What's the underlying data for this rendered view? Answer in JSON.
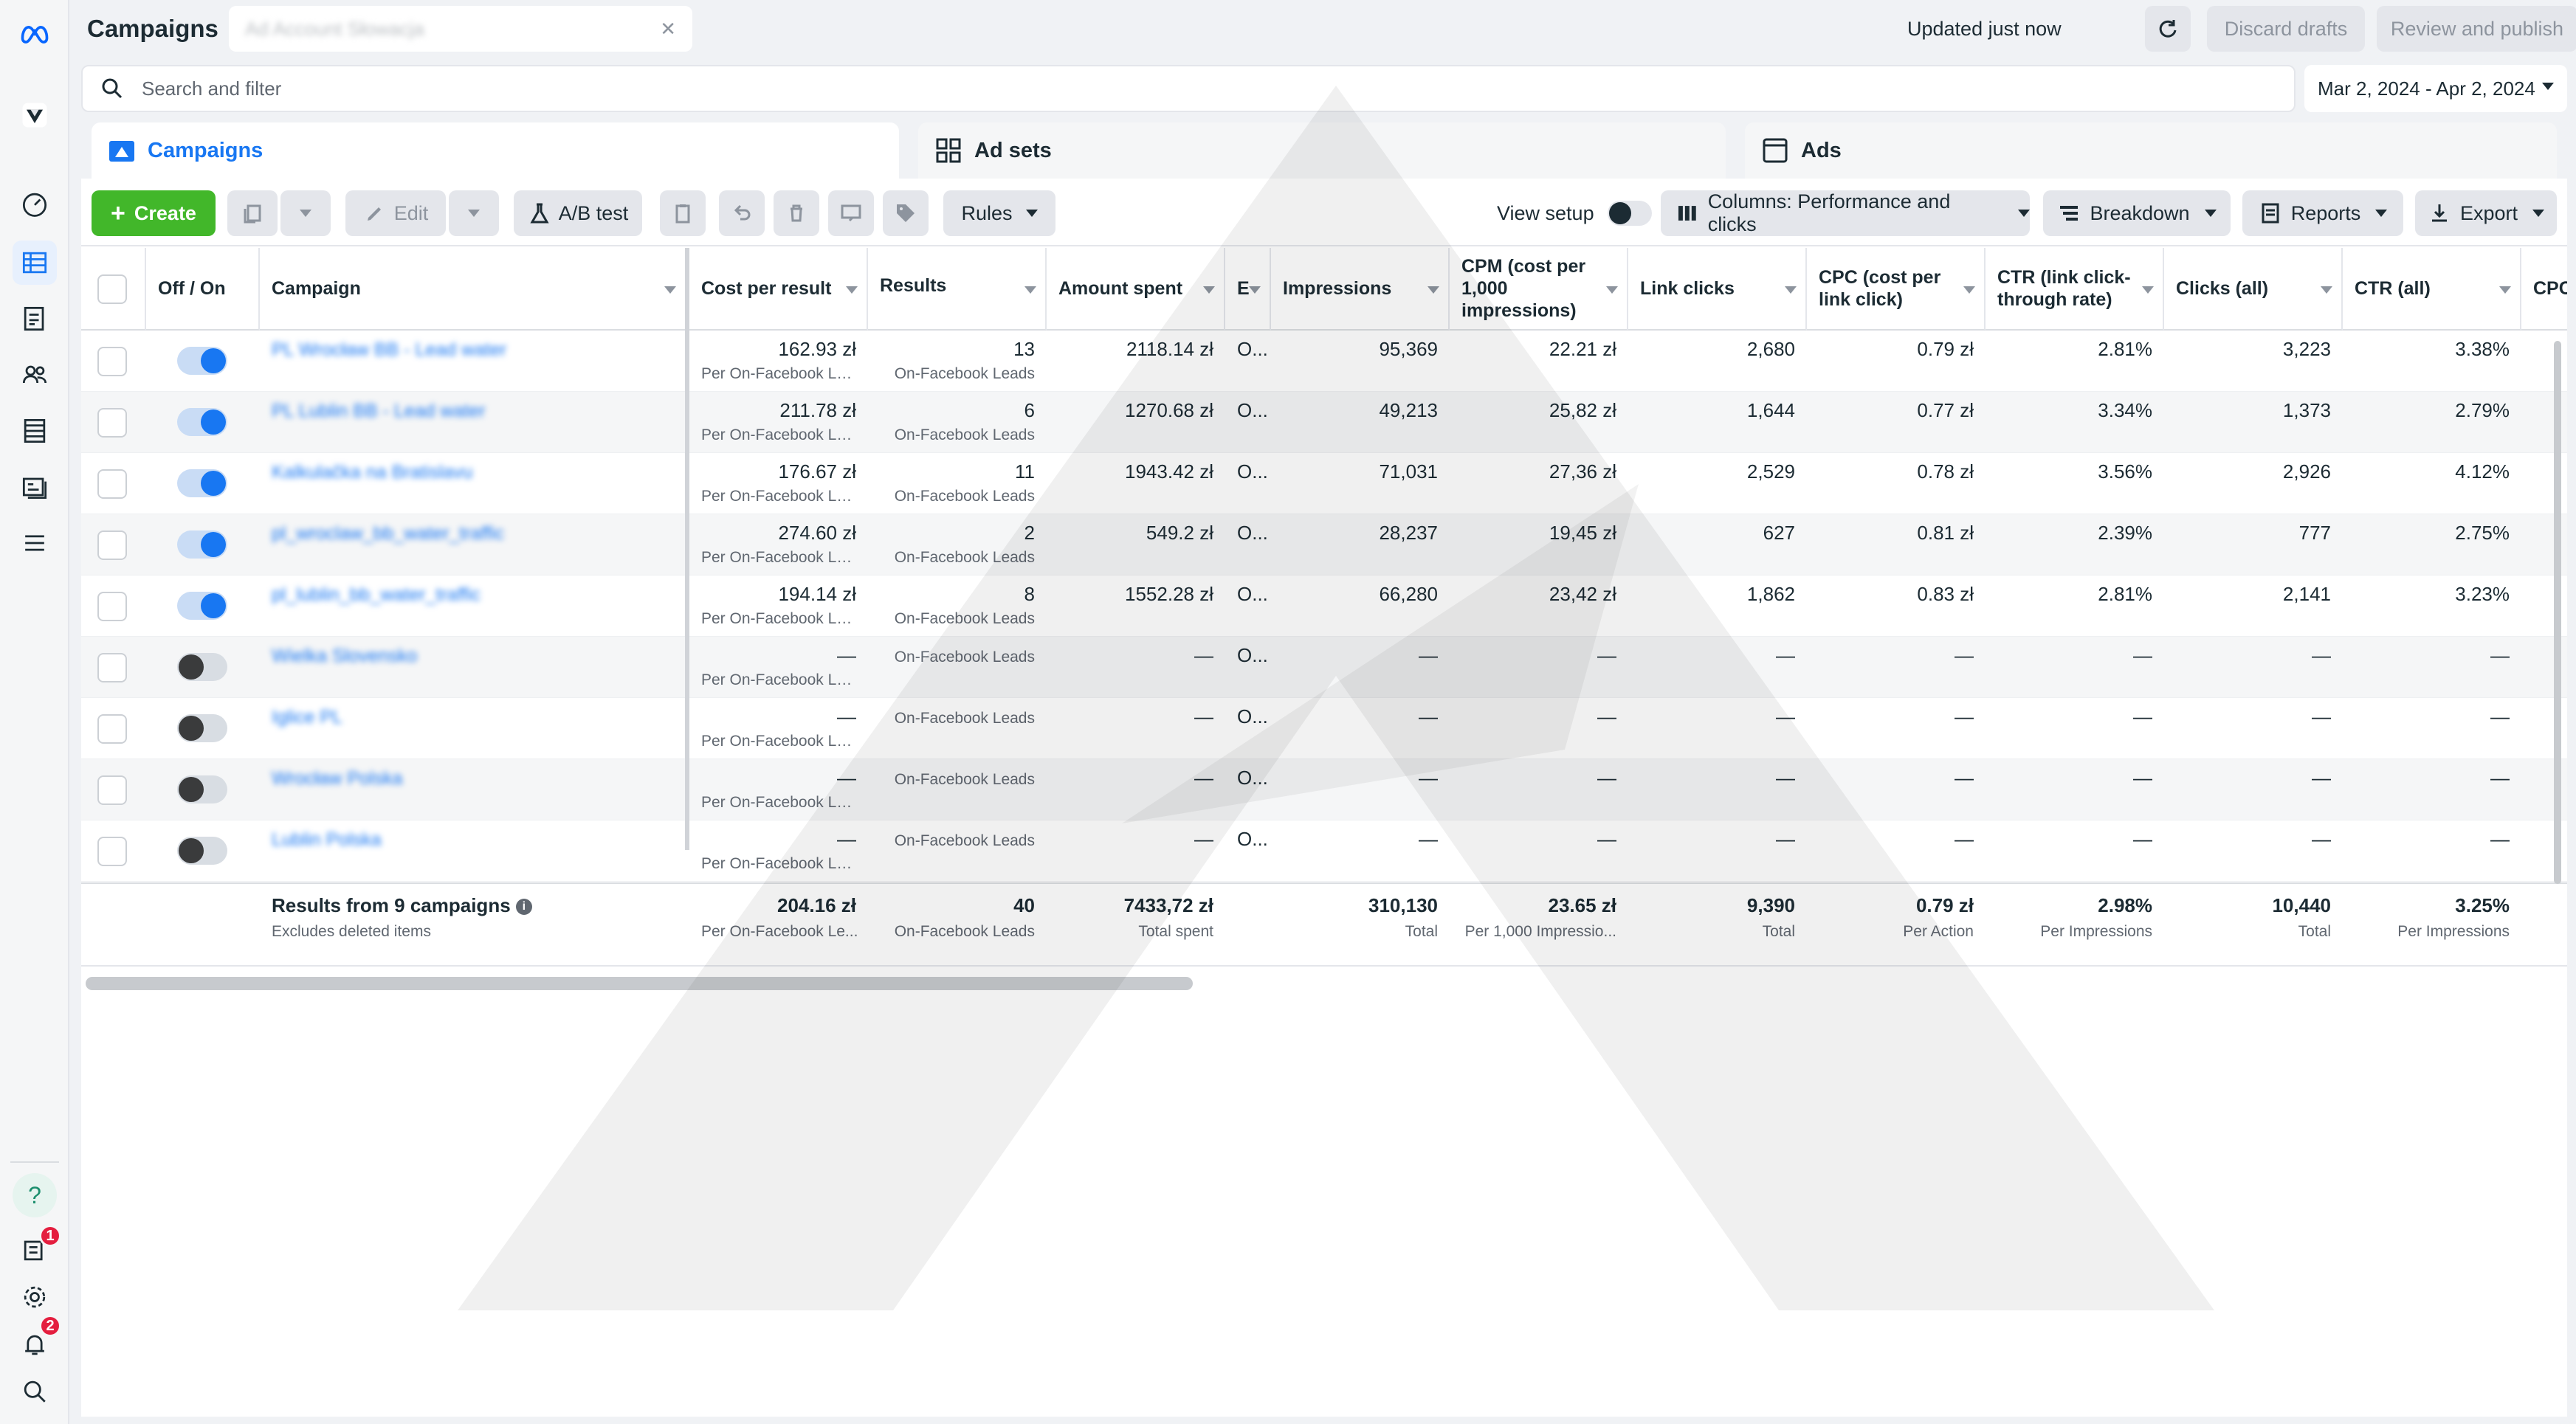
{
  "topbar": {
    "title": "Campaigns",
    "account_name": "Ad Account Słowacja",
    "updated": "Updated just now",
    "discard": "Discard drafts",
    "publish": "Review and publish",
    "more": "···"
  },
  "search": {
    "placeholder": "Search and filter"
  },
  "date_range": "Mar 2, 2024 - Apr 2, 2024",
  "tabs": [
    {
      "label": "Campaigns",
      "icon": "folder-icon"
    },
    {
      "label": "Ad sets",
      "icon": "grid-icon"
    },
    {
      "label": "Ads",
      "icon": "ad-icon"
    }
  ],
  "toolbar": {
    "create": "Create",
    "edit": "Edit",
    "ab_test": "A/B test",
    "rules": "Rules",
    "view_setup": "View setup",
    "columns": "Columns: Performance and clicks",
    "breakdown": "Breakdown",
    "reports": "Reports",
    "export": "Export"
  },
  "table": {
    "headers": {
      "offon": "Off / On",
      "campaign": "Campaign",
      "cost_per_result": "Cost per result",
      "results": "Results",
      "amount_spent": "Amount spent",
      "ends": "E",
      "impressions": "Impressions",
      "cpm": "CPM (cost per 1,000 impressions)",
      "link_clicks": "Link clicks",
      "cpc_link": "CPC (cost per link click)",
      "ctr_link": "CTR (link click-through rate)",
      "clicks_all": "Clicks (all)",
      "ctr_all": "CTR (all)",
      "cpc": "CPC"
    },
    "rows": [
      {
        "on": true,
        "name": "PL Wrocław BB - Lead water",
        "cpr": "162.93 zł",
        "cpr_sub": "Per On-Facebook Le...",
        "results": "13",
        "results_sub": "On-Facebook Leads",
        "spent": "2118.14 zł",
        "ends": "O...",
        "impr": "95,369",
        "cpm": "22.21 zł",
        "link": "2,680",
        "cpc_link": "0.79 zł",
        "ctr_link": "2.81%",
        "clicks": "3,223",
        "ctr_all": "3.38%"
      },
      {
        "on": true,
        "name": "PL Lublin BB - Lead water",
        "cpr": "211.78 zł",
        "cpr_sub": "Per On-Facebook Le...",
        "results": "6",
        "results_sub": "On-Facebook Leads",
        "spent": "1270.68 zł",
        "ends": "O...",
        "impr": "49,213",
        "cpm": "25,82 zł",
        "link": "1,644",
        "cpc_link": "0.77 zł",
        "ctr_link": "3.34%",
        "clicks": "1,373",
        "ctr_all": "2.79%"
      },
      {
        "on": true,
        "name": "Kalkulačka na Bratislavu",
        "cpr": "176.67 zł",
        "cpr_sub": "Per On-Facebook Le...",
        "results": "11",
        "results_sub": "On-Facebook Leads",
        "spent": "1943.42 zł",
        "ends": "O...",
        "impr": "71,031",
        "cpm": "27,36 zł",
        "link": "2,529",
        "cpc_link": "0.78 zł",
        "ctr_link": "3.56%",
        "clicks": "2,926",
        "ctr_all": "4.12%"
      },
      {
        "on": true,
        "name": "pl_wroclaw_bb_water_traffic",
        "cpr": "274.60 zł",
        "cpr_sub": "Per On-Facebook Le...",
        "results": "2",
        "results_sub": "On-Facebook Leads",
        "spent": "549.2 zł",
        "ends": "O...",
        "impr": "28,237",
        "cpm": "19,45 zł",
        "link": "627",
        "cpc_link": "0.81 zł",
        "ctr_link": "2.39%",
        "clicks": "777",
        "ctr_all": "2.75%"
      },
      {
        "on": true,
        "name": "pl_lublin_bb_water_traffic",
        "cpr": "194.14 zł",
        "cpr_sub": "Per On-Facebook Le...",
        "results": "8",
        "results_sub": "On-Facebook Leads",
        "spent": "1552.28 zł",
        "ends": "O...",
        "impr": "66,280",
        "cpm": "23,42 zł",
        "link": "1,862",
        "cpc_link": "0.83 zł",
        "ctr_link": "2.81%",
        "clicks": "2,141",
        "ctr_all": "3.23%"
      },
      {
        "on": false,
        "name": "Wielka Slovensko",
        "cpr": "—",
        "cpr_sub": "Per On-Facebook Le...",
        "results": "",
        "results_sub": "On-Facebook Leads",
        "spent": "—",
        "ends": "O...",
        "impr": "—",
        "cpm": "—",
        "link": "—",
        "cpc_link": "—",
        "ctr_link": "—",
        "clicks": "—",
        "ctr_all": "—"
      },
      {
        "on": false,
        "name": "Iglice PL",
        "cpr": "—",
        "cpr_sub": "Per On-Facebook Le...",
        "results": "",
        "results_sub": "On-Facebook Leads",
        "spent": "—",
        "ends": "O...",
        "impr": "—",
        "cpm": "—",
        "link": "—",
        "cpc_link": "—",
        "ctr_link": "—",
        "clicks": "—",
        "ctr_all": "—"
      },
      {
        "on": false,
        "name": "Wrocław Polska",
        "cpr": "—",
        "cpr_sub": "Per On-Facebook Le...",
        "results": "",
        "results_sub": "On-Facebook Leads",
        "spent": "—",
        "ends": "O...",
        "impr": "—",
        "cpm": "—",
        "link": "—",
        "cpc_link": "—",
        "ctr_link": "—",
        "clicks": "—",
        "ctr_all": "—"
      },
      {
        "on": false,
        "name": "Lublin Polska",
        "cpr": "—",
        "cpr_sub": "Per On-Facebook Le...",
        "results": "",
        "results_sub": "On-Facebook Leads",
        "spent": "—",
        "ends": "O...",
        "impr": "—",
        "cpm": "—",
        "link": "—",
        "cpc_link": "—",
        "ctr_link": "—",
        "clicks": "—",
        "ctr_all": "—"
      }
    ],
    "totals": {
      "label": "Results from 9 campaigns",
      "label_sub": "Excludes deleted items",
      "cpr": "204.16 zł",
      "cpr_sub": "Per On-Facebook Le...",
      "results": "40",
      "results_sub": "On-Facebook Leads",
      "spent": "7433,72 zł",
      "spent_sub": "Total spent",
      "impr": "310,130",
      "impr_sub": "Total",
      "cpm": "23.65 zł",
      "cpm_sub": "Per 1,000 Impressio...",
      "link": "9,390",
      "link_sub": "Total",
      "cpc_link": "0.79 zł",
      "cpc_link_sub": "Per Action",
      "ctr_link": "2.98%",
      "ctr_link_sub": "Per Impressions",
      "clicks": "10,440",
      "clicks_sub": "Total",
      "ctr_all": "3.25%",
      "ctr_all_sub": "Per Impressions"
    }
  },
  "rail": {
    "badges": {
      "notifications_center": "1",
      "alerts": "2"
    },
    "help_label": "?"
  },
  "colors": {
    "accent": "#1877f2",
    "create": "#42b72a",
    "badge": "#e41e3f"
  }
}
